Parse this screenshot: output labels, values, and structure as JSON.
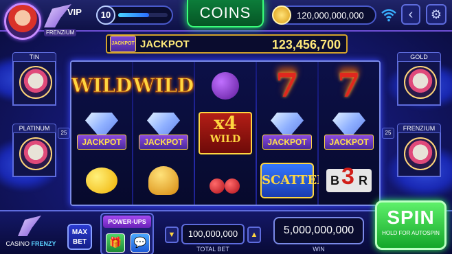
{
  "player": {
    "level": "10",
    "level_progress": 0.62,
    "vip_label": "VIP",
    "vip_tier": "FRENZIUM"
  },
  "header": {
    "coins_label": "COINS",
    "balance": "120,000,000,000"
  },
  "jackpot": {
    "logo_text": "JACKPOT",
    "label": "JACKPOT",
    "value": "123,456,700"
  },
  "tiers": {
    "tin": {
      "label": "TIN"
    },
    "platinum": {
      "label": "PLATINUM",
      "count": "25"
    },
    "gold": {
      "label": "GOLD"
    },
    "frenzium": {
      "label": "FRENZIUM",
      "count": "25"
    }
  },
  "reels": [
    [
      "WILD",
      "JACKPOT",
      "lemon"
    ],
    [
      "WILD",
      "JACKPOT",
      "bell"
    ],
    [
      "plum",
      "x4 WILD",
      "cherries"
    ],
    [
      "7",
      "JACKPOT",
      "SCATTER"
    ],
    [
      "7",
      "JACKPOT",
      "B3R"
    ]
  ],
  "symbols": {
    "wild": "WILD",
    "jackpot": "JACKPOT",
    "seven": "7",
    "x4": "x4",
    "x4_sub": "WILD",
    "scatter": "SCATTER",
    "bar_left": "B",
    "bar_three": "3",
    "bar_right": "R"
  },
  "bottom": {
    "logo_text_a": "CASINO",
    "logo_text_b": "FRENZY",
    "maxbet_line1": "MAX",
    "maxbet_line2": "BET",
    "powerups_title": "POWER-UPS",
    "total_bet": "100,000,000",
    "total_bet_label": "TOTAL BET",
    "win": "5,000,000,000",
    "win_label": "WIN",
    "spin_label": "SPIN",
    "spin_sub": "HOLD FOR AUTOSPIN"
  },
  "colors": {
    "accent_green": "#39ff7a",
    "gold": "#ffd640",
    "panel": "#0a0c2e"
  }
}
